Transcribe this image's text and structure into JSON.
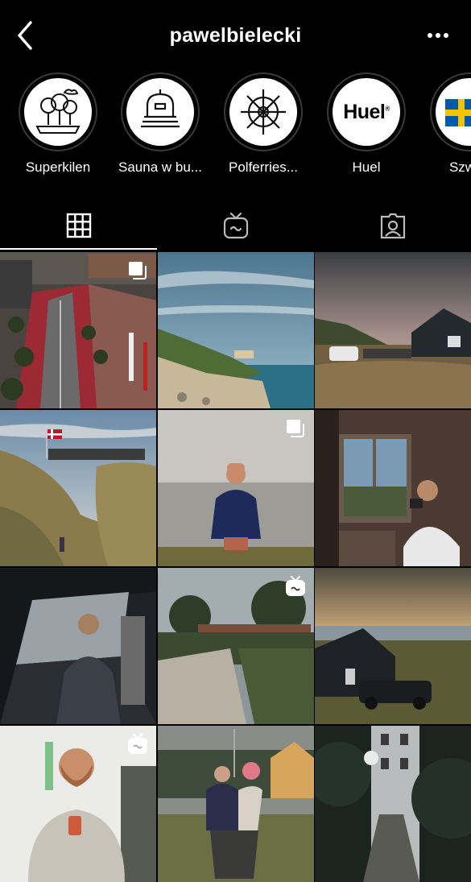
{
  "header": {
    "title": "pawelbielecki",
    "back_icon": "chevron-left-icon",
    "more_icon": "more-horizontal-icon"
  },
  "highlights": [
    {
      "label": "Superkilen",
      "icon": "trees-icon"
    },
    {
      "label": "Sauna w bu...",
      "icon": "sauna-icon"
    },
    {
      "label": "Polferries...",
      "icon": "ship-wheel-icon"
    },
    {
      "label": "Huel",
      "icon": "huel-logo",
      "logo_text": "Huel",
      "logo_mark": "®"
    },
    {
      "label": "Szwec",
      "icon": "swedish-flag-icon"
    }
  ],
  "tabs": [
    {
      "name": "posts-grid",
      "icon": "grid-icon",
      "active": true
    },
    {
      "name": "igtv",
      "icon": "igtv-icon",
      "active": false
    },
    {
      "name": "tagged",
      "icon": "tagged-user-icon",
      "active": false
    }
  ],
  "posts": [
    {
      "scene": "city-aerial",
      "badge": "carousel-icon"
    },
    {
      "scene": "cliff-sea",
      "badge": null
    },
    {
      "scene": "cabin-dusk",
      "badge": null
    },
    {
      "scene": "dunes-flag",
      "badge": null
    },
    {
      "scene": "child-sea",
      "badge": "carousel-icon"
    },
    {
      "scene": "photographer-window",
      "badge": null
    },
    {
      "scene": "car-driver",
      "badge": null
    },
    {
      "scene": "village-road",
      "badge": "igtv-icon"
    },
    {
      "scene": "cabin-car",
      "badge": null
    },
    {
      "scene": "selfie",
      "badge": "igtv-icon"
    },
    {
      "scene": "mother-child",
      "badge": null
    },
    {
      "scene": "street-alley",
      "badge": null
    }
  ],
  "colors": {
    "background": "#000000",
    "text": "#ffffff",
    "ring": "#3a3a3a",
    "danish_flag_red": "#c8102e",
    "swedish_blue": "#005bac",
    "swedish_yellow": "#f5c400"
  }
}
